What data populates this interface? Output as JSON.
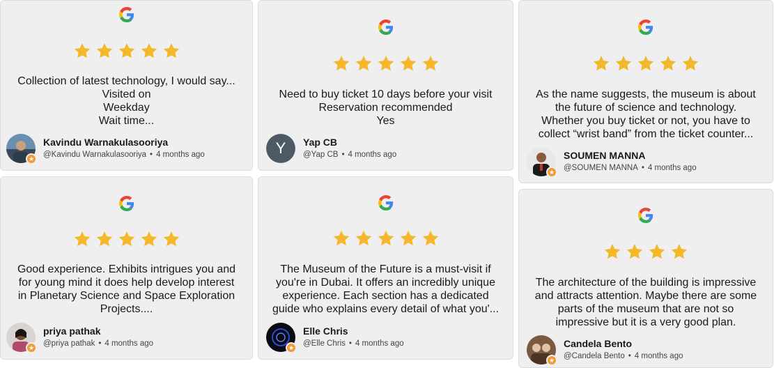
{
  "colors": {
    "card_bg": "#efefef",
    "star": "#f5b82a",
    "badge": "#f29a3a"
  },
  "reviews": [
    {
      "rating": 5,
      "text_lines": [
        "Collection of latest technology, I would say...",
        "Visited on",
        "Weekday",
        "Wait time..."
      ],
      "name": "Kavindu Warnakulasooriya",
      "handle": "@Kavindu Warnakulasooriya",
      "time": "4 months ago",
      "avatar": "photo"
    },
    {
      "rating": 5,
      "text_lines": [
        "Need to buy ticket 10 days before your visit",
        "Reservation recommended",
        "Yes"
      ],
      "name": "Yap CB",
      "handle": "@Yap CB",
      "time": "4 months ago",
      "avatar_letter": "Y"
    },
    {
      "rating": 5,
      "text_lines": [
        "As the name suggests, the museum is about",
        "the future of science and technology.",
        "Whether you buy ticket or not, you have to",
        "collect “wrist band” from the ticket counter..."
      ],
      "name": "SOUMEN MANNA",
      "handle": "@SOUMEN MANNA",
      "time": "4 months ago",
      "avatar": "photo"
    },
    {
      "rating": 5,
      "text_lines": [
        "Good experience. Exhibits intrigues you and",
        "for young mind it does help develop interest",
        "in Planetary Science and Space Exploration",
        "Projects...."
      ],
      "name": "priya pathak",
      "handle": "@priya pathak",
      "time": "4 months ago",
      "avatar": "photo"
    },
    {
      "rating": 5,
      "text_lines": [
        "The Museum of the Future is a must-visit if",
        "you're in Dubai. It offers an incredibly unique",
        "experience. Each section has a dedicated",
        "guide who explains every detail of what you'..."
      ],
      "name": "Elle Chris",
      "handle": "@Elle Chris",
      "time": "4 months ago",
      "avatar": "photo"
    },
    {
      "rating": 4,
      "text_lines": [
        "The architecture of the building is impressive",
        "and attracts attention. Maybe there are some",
        "parts of the museum that are not so",
        "impressive but it is a very good plan."
      ],
      "name": "Candela Bento",
      "handle": "@Candela Bento",
      "time": "4 months ago",
      "avatar": "photo"
    }
  ]
}
